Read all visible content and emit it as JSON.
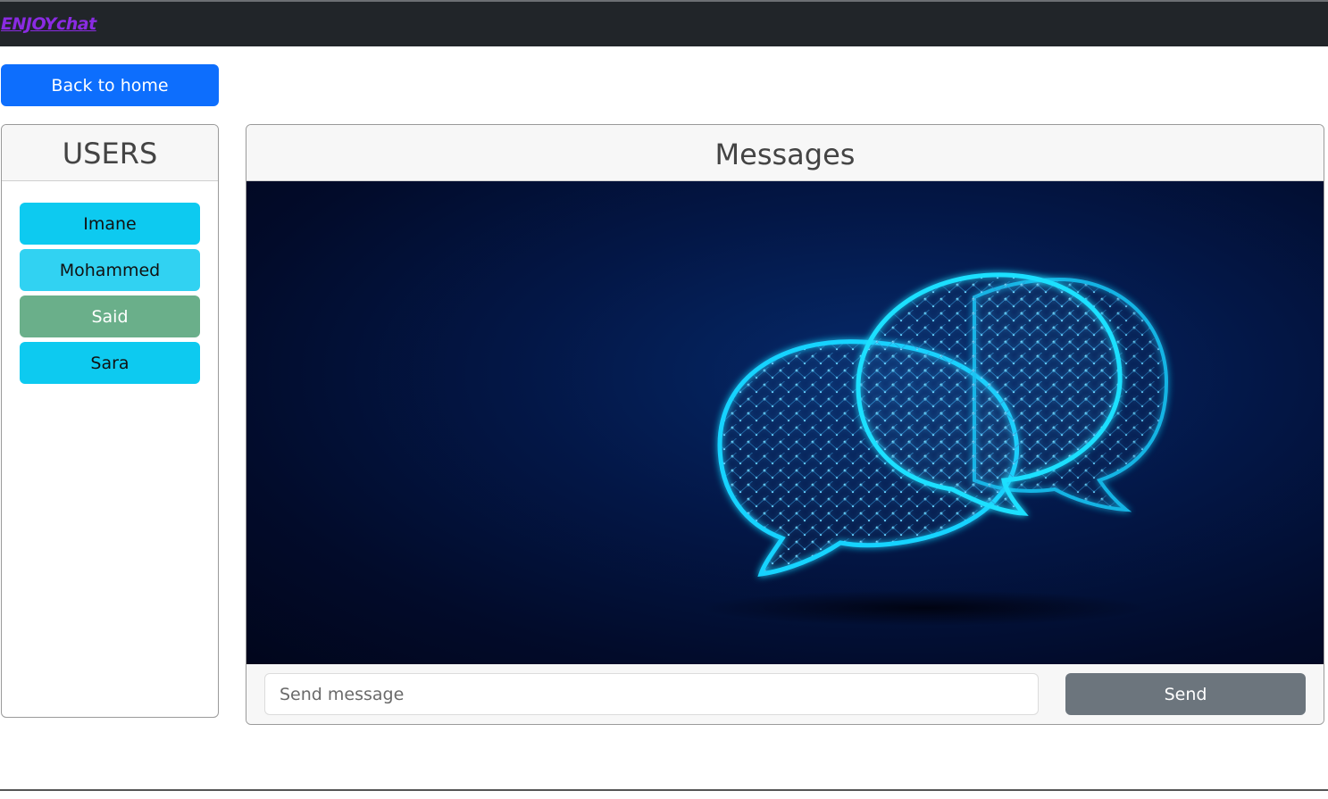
{
  "navbar": {
    "brand": "ENJOYchat"
  },
  "back_button": {
    "label": "Back to home"
  },
  "users_panel": {
    "title": "USERS",
    "users": [
      {
        "name": "Imane",
        "color": "#0dcaf0",
        "text_color": "#111111"
      },
      {
        "name": "Mohammed",
        "color": "#31d2f2",
        "text_color": "#111111"
      },
      {
        "name": "Said",
        "color": "#6aaf8a",
        "text_color": "#ffffff"
      },
      {
        "name": "Sara",
        "color": "#0dcaf0",
        "text_color": "#111111"
      }
    ]
  },
  "messages_panel": {
    "title": "Messages",
    "illustration": "chat-bubbles-network-illustration",
    "composer": {
      "placeholder": "Send message",
      "value": "",
      "send_label": "Send"
    }
  },
  "colors": {
    "navbar_bg": "#212529",
    "brand": "#8a2be2",
    "primary": "#0d6efd",
    "secondary": "#6c757d"
  }
}
